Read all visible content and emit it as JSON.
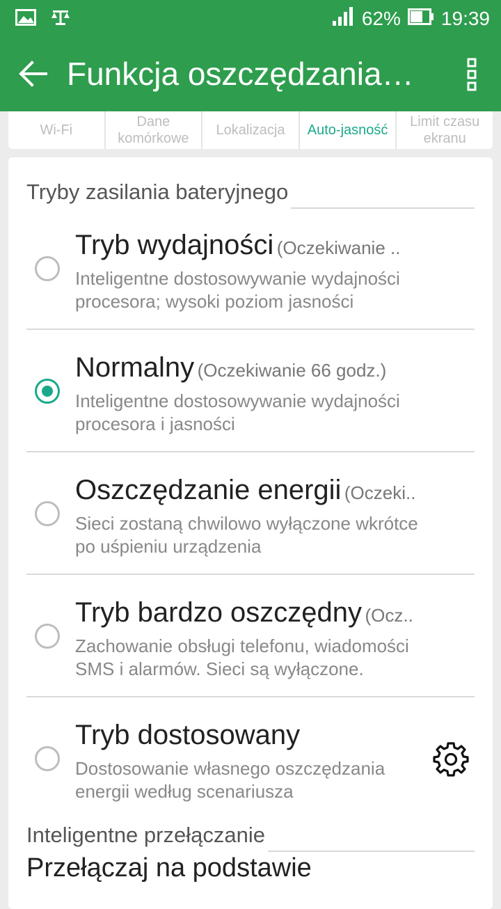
{
  "status_bar": {
    "icons": [
      "image-icon",
      "scale-icon"
    ],
    "battery_percent": "62%",
    "time": "19:39"
  },
  "app_bar": {
    "title": "Funkcja oszczędzania…"
  },
  "tabs": [
    {
      "label": "Wi-Fi",
      "active": false
    },
    {
      "label": "Dane komórkowe",
      "active": false
    },
    {
      "label": "Lokalizacja",
      "active": false
    },
    {
      "label": "Auto-jasność",
      "active": true
    },
    {
      "label": "Limit czasu ekranu",
      "active": false
    }
  ],
  "section_battery": {
    "header": "Tryby zasilania bateryjnego",
    "options": [
      {
        "title": "Tryb wydajności",
        "subtitle": "(Oczekiwanie ..",
        "description": "Inteligentne dostosowywanie wydajności procesora; wysoki poziom jasności",
        "selected": false
      },
      {
        "title": "Normalny",
        "subtitle": "(Oczekiwanie 66 godz.)",
        "description": "Inteligentne dostosowywanie wydajności procesora i jasności",
        "selected": true
      },
      {
        "title": "Oszczędzanie energii",
        "subtitle": "(Oczeki..",
        "description": "Sieci zostaną chwilowo wyłączone wkrótce po uśpieniu urządzenia",
        "selected": false
      },
      {
        "title": "Tryb bardzo oszczędny",
        "subtitle": "(Ocz..",
        "description": "Zachowanie obsługi telefonu, wiadomości SMS i alarmów. Sieci są wyłączone.",
        "selected": false
      },
      {
        "title": "Tryb dostosowany",
        "subtitle": "",
        "description": "Dostosowanie własnego oszczędzania energii według scenariusza",
        "selected": false,
        "has_settings": true
      }
    ]
  },
  "section_switch": {
    "header": "Inteligentne przełączanie",
    "item_title": "Przełączaj na podstawie"
  },
  "colors": {
    "brand": "#2e9d4e",
    "accent": "#19a98a"
  }
}
